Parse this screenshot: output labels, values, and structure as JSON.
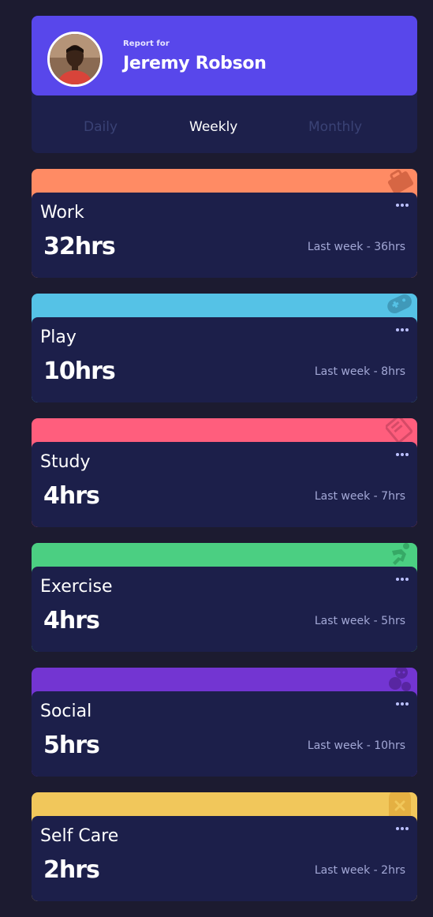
{
  "profile": {
    "report_for": "Report for",
    "name": "Jeremy Robson"
  },
  "tabs": [
    {
      "label": "Daily",
      "active": false
    },
    {
      "label": "Weekly",
      "active": true
    },
    {
      "label": "Monthly",
      "active": false
    }
  ],
  "activities": [
    {
      "title": "Work",
      "current": "32hrs",
      "previous": "Last week - 36hrs",
      "color": "#ff8b64",
      "icon": "briefcase-icon"
    },
    {
      "title": "Play",
      "current": "10hrs",
      "previous": "Last week - 8hrs",
      "color": "#55c2e6",
      "icon": "gamepad-icon"
    },
    {
      "title": "Study",
      "current": "4hrs",
      "previous": "Last week - 7hrs",
      "color": "#ff5e7d",
      "icon": "book-icon"
    },
    {
      "title": "Exercise",
      "current": "4hrs",
      "previous": "Last week - 5hrs",
      "color": "#4bcf82",
      "icon": "running-icon"
    },
    {
      "title": "Social",
      "current": "5hrs",
      "previous": "Last week - 10hrs",
      "color": "#7335d2",
      "icon": "chat-icon"
    },
    {
      "title": "Self Care",
      "current": "2hrs",
      "previous": "Last week - 2hrs",
      "color": "#f1c75b",
      "icon": "heart-icon"
    }
  ],
  "colors": {
    "page_bg": "#1c1b30",
    "card_bg": "#1c1f4a",
    "profile_accent": "#5847eb"
  }
}
